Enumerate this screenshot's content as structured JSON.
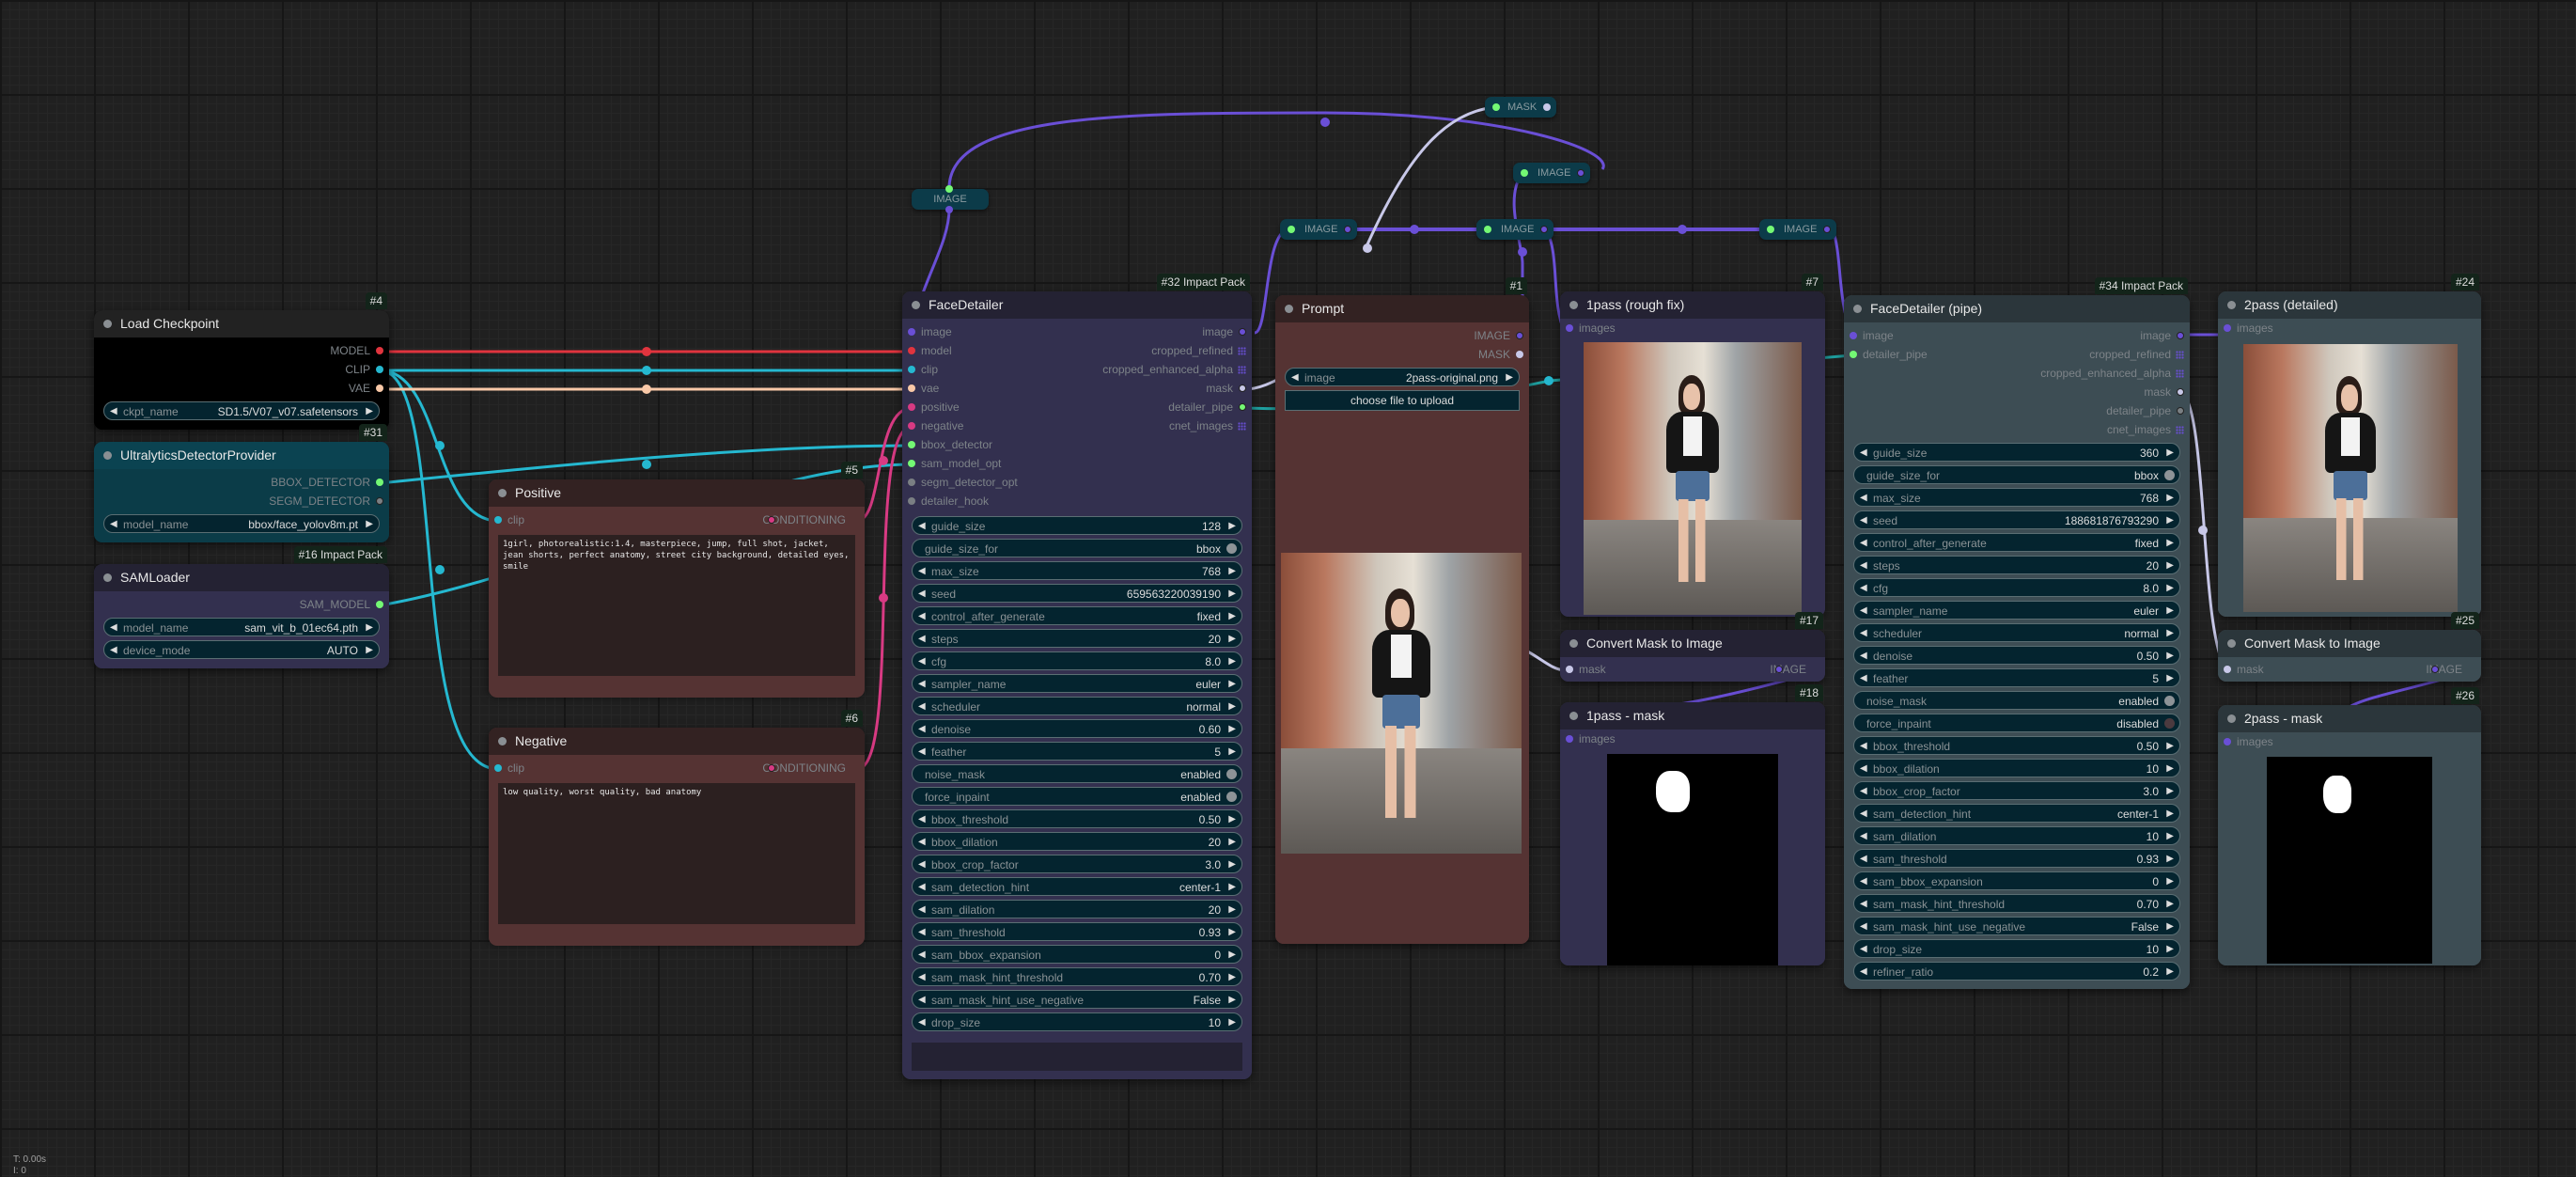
{
  "colors": {
    "model": "#e0343e",
    "clip": "#25b8d0",
    "vae": "#f9c8a7",
    "conditioning": "#d83a83",
    "image": "#6a4fd6",
    "mask": "#c8c8e8",
    "detector": "#74f874",
    "inactive": "#7a7f83"
  },
  "nodes": {
    "load_checkpoint": {
      "badge": "#4",
      "title": "Load Checkpoint",
      "outputs": [
        "MODEL",
        "CLIP",
        "VAE"
      ],
      "widgets": [
        {
          "label": "ckpt_name",
          "value": "SD1.5/V07_v07.safetensors"
        }
      ]
    },
    "ultralytics": {
      "badge": "#31",
      "title": "UltralyticsDetectorProvider",
      "outputs": [
        "BBOX_DETECTOR",
        "SEGM_DETECTOR"
      ],
      "widgets": [
        {
          "label": "model_name",
          "value": "bbox/face_yolov8m.pt"
        }
      ]
    },
    "samloader": {
      "badge": "#16 Impact Pack",
      "title": "SAMLoader",
      "outputs": [
        "SAM_MODEL"
      ],
      "widgets": [
        {
          "label": "model_name",
          "value": "sam_vit_b_01ec64.pth"
        },
        {
          "label": "device_mode",
          "value": "AUTO"
        }
      ]
    },
    "positive": {
      "badge": "#5",
      "title": "Positive",
      "input": "clip",
      "output": "CONDITIONING",
      "text": "1girl, photorealistic:1.4, masterpiece, jump, full shot, jacket, jean shorts, perfect anatomy, street city background, detailed eyes, smile"
    },
    "negative": {
      "badge": "#6",
      "title": "Negative",
      "input": "clip",
      "output": "CONDITIONING",
      "text": "low quality, worst quality, bad anatomy"
    },
    "facedetailer": {
      "badge": "#32 Impact Pack",
      "title": "FaceDetailer",
      "inputs": [
        "image",
        "model",
        "clip",
        "vae",
        "positive",
        "negative",
        "bbox_detector",
        "sam_model_opt",
        "segm_detector_opt",
        "detailer_hook"
      ],
      "outputs": [
        "image",
        "cropped_refined",
        "cropped_enhanced_alpha",
        "mask",
        "detailer_pipe",
        "cnet_images"
      ],
      "widgets": [
        {
          "label": "guide_size",
          "value": "128"
        },
        {
          "label": "guide_size_for",
          "value": "bbox",
          "toggle": true,
          "on": true
        },
        {
          "label": "max_size",
          "value": "768"
        },
        {
          "label": "seed",
          "value": "659563220039190"
        },
        {
          "label": "control_after_generate",
          "value": "fixed"
        },
        {
          "label": "steps",
          "value": "20"
        },
        {
          "label": "cfg",
          "value": "8.0"
        },
        {
          "label": "sampler_name",
          "value": "euler"
        },
        {
          "label": "scheduler",
          "value": "normal"
        },
        {
          "label": "denoise",
          "value": "0.60"
        },
        {
          "label": "feather",
          "value": "5"
        },
        {
          "label": "noise_mask",
          "value": "enabled",
          "toggle": true,
          "on": true
        },
        {
          "label": "force_inpaint",
          "value": "enabled",
          "toggle": true,
          "on": true
        },
        {
          "label": "bbox_threshold",
          "value": "0.50"
        },
        {
          "label": "bbox_dilation",
          "value": "20"
        },
        {
          "label": "bbox_crop_factor",
          "value": "3.0"
        },
        {
          "label": "sam_detection_hint",
          "value": "center-1"
        },
        {
          "label": "sam_dilation",
          "value": "20"
        },
        {
          "label": "sam_threshold",
          "value": "0.93"
        },
        {
          "label": "sam_bbox_expansion",
          "value": "0"
        },
        {
          "label": "sam_mask_hint_threshold",
          "value": "0.70"
        },
        {
          "label": "sam_mask_hint_use_negative",
          "value": "False"
        },
        {
          "label": "drop_size",
          "value": "10"
        }
      ]
    },
    "prompt": {
      "badge": "#1",
      "title": "Prompt",
      "outputs": [
        "IMAGE",
        "MASK"
      ],
      "widgets": [
        {
          "label": "image",
          "value": "2pass-original.png"
        }
      ],
      "upload_button": "choose file to upload"
    },
    "pass1": {
      "badge": "#7",
      "title": "1pass (rough fix)",
      "input": "images"
    },
    "convert1": {
      "badge": "#17",
      "title": "Convert Mask to Image",
      "input": "mask",
      "output": "IMAGE"
    },
    "pass1mask": {
      "badge": "#18",
      "title": "1pass - mask",
      "input": "images"
    },
    "facedetailer_pipe": {
      "badge": "#34 Impact Pack",
      "title": "FaceDetailer (pipe)",
      "inputs": [
        "image",
        "detailer_pipe"
      ],
      "outputs": [
        "image",
        "cropped_refined",
        "cropped_enhanced_alpha",
        "mask",
        "detailer_pipe",
        "cnet_images"
      ],
      "widgets": [
        {
          "label": "guide_size",
          "value": "360"
        },
        {
          "label": "guide_size_for",
          "value": "bbox",
          "toggle": true,
          "on": true
        },
        {
          "label": "max_size",
          "value": "768"
        },
        {
          "label": "seed",
          "value": "188681876793290"
        },
        {
          "label": "control_after_generate",
          "value": "fixed"
        },
        {
          "label": "steps",
          "value": "20"
        },
        {
          "label": "cfg",
          "value": "8.0"
        },
        {
          "label": "sampler_name",
          "value": "euler"
        },
        {
          "label": "scheduler",
          "value": "normal"
        },
        {
          "label": "denoise",
          "value": "0.50"
        },
        {
          "label": "feather",
          "value": "5"
        },
        {
          "label": "noise_mask",
          "value": "enabled",
          "toggle": true,
          "on": true
        },
        {
          "label": "force_inpaint",
          "value": "disabled",
          "toggle": true,
          "on": false
        },
        {
          "label": "bbox_threshold",
          "value": "0.50"
        },
        {
          "label": "bbox_dilation",
          "value": "10"
        },
        {
          "label": "bbox_crop_factor",
          "value": "3.0"
        },
        {
          "label": "sam_detection_hint",
          "value": "center-1"
        },
        {
          "label": "sam_dilation",
          "value": "10"
        },
        {
          "label": "sam_threshold",
          "value": "0.93"
        },
        {
          "label": "sam_bbox_expansion",
          "value": "0"
        },
        {
          "label": "sam_mask_hint_threshold",
          "value": "0.70"
        },
        {
          "label": "sam_mask_hint_use_negative",
          "value": "False"
        },
        {
          "label": "drop_size",
          "value": "10"
        },
        {
          "label": "refiner_ratio",
          "value": "0.2"
        }
      ]
    },
    "pass2": {
      "badge": "#24",
      "title": "2pass (detailed)",
      "input": "images"
    },
    "convert2": {
      "badge": "#25",
      "title": "Convert Mask to Image",
      "input": "mask",
      "output": "IMAGE"
    },
    "pass2mask": {
      "badge": "#26",
      "title": "2pass - mask",
      "input": "images"
    }
  },
  "reroutes": {
    "r1": "IMAGE",
    "r2": "IMAGE",
    "r3": "IMAGE",
    "r4": "IMAGE",
    "r5": "MASK",
    "r6": "IMAGE"
  },
  "stats": {
    "time": "T: 0.00s",
    "iterations": "I: 0"
  }
}
